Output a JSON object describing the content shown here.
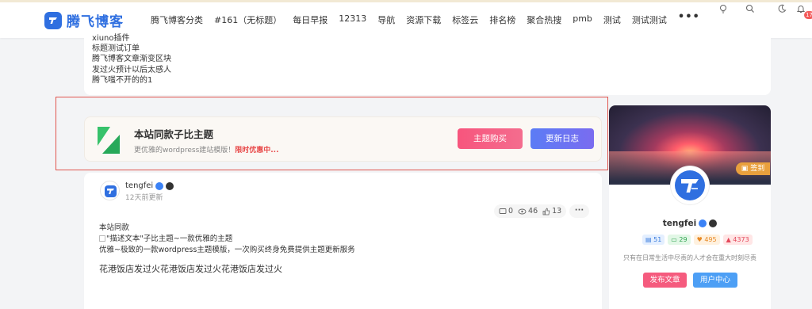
{
  "brand": {
    "name": "腾飞博客",
    "color": "#2f6fe0"
  },
  "nav": {
    "items": [
      "腾飞博客分类",
      "#161（无标题）",
      "每日早报",
      "12313",
      "导航",
      "资源下载",
      "标签云",
      "排名榜",
      "聚合热搜",
      "pmb",
      "测试",
      "测试测试"
    ],
    "more": "•••",
    "icons": [
      "lightbulb-icon",
      "search-icon",
      "moon-icon",
      "bell-icon"
    ],
    "notification_count": "17"
  },
  "top_list": [
    "xiuno插件",
    "标题测试订单",
    "腾飞博客文章渐变区块",
    "发过火预计以后太感人",
    "腾飞嗤不开的的1"
  ],
  "promo": {
    "title": "本站同款子比主题",
    "subtitle": "更优雅的wordpress建站模版！",
    "highlight": "限时优惠中...",
    "buy_label": "主题购买",
    "changelog_label": "更新日志"
  },
  "post": {
    "author": "tengfei",
    "updated": "12天前更新",
    "stats": {
      "comments": "0",
      "views": "46",
      "likes": "13"
    },
    "lines": [
      "本站同款",
      "\"描述文本\"子比主题~一款优雅的主题",
      "优雅~极致的一款wordpress主题模版，一次购买终身免费提供主题更新服务"
    ],
    "big_text": "花港饭店发过火花港饭店发过火花港饭店发过火"
  },
  "sidebar": {
    "checkin_label": "签到",
    "username": "tengfei",
    "chips": [
      "51",
      "29",
      "495",
      "4373"
    ],
    "bio": "只有在日常生活中尽责的人才会在重大时刻尽责",
    "post_button": "发布文章",
    "user_button": "用户中心"
  }
}
